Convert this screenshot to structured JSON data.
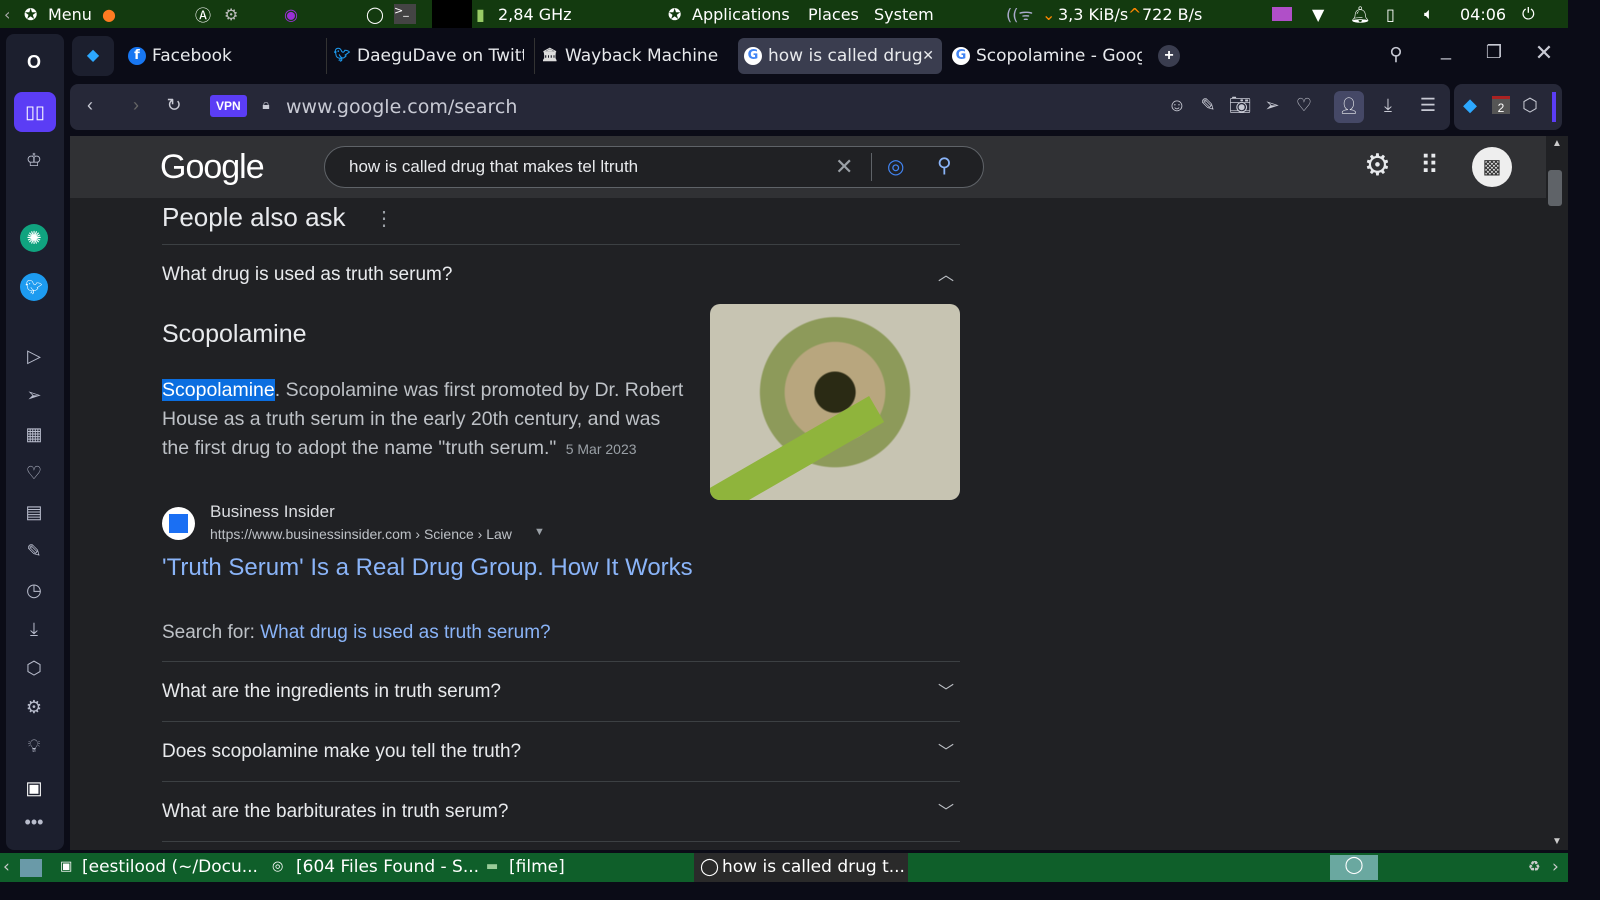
{
  "topbar": {
    "menu": "Menu",
    "cpu": "2,84 GHz",
    "applications": "Applications",
    "places": "Places",
    "system": "System",
    "net_down": "3,3 KiB/s",
    "net_up": "722 B/s",
    "clock": "04:06"
  },
  "tabs": [
    {
      "label": "Facebook"
    },
    {
      "label": "DaeguDave on Twitt"
    },
    {
      "label": "Wayback Machine"
    },
    {
      "label": "how is called drug"
    },
    {
      "label": "Scopolamine - Googl"
    }
  ],
  "address": {
    "vpn": "VPN",
    "url": "www.google.com/search"
  },
  "extensions": {
    "badge": "2"
  },
  "google": {
    "logo": "Google",
    "query": "how is called drug that makes tel ltruth"
  },
  "paa": {
    "title": "People also ask",
    "expanded_question": "What drug is used as truth serum?",
    "answer_title": "Scopolamine",
    "answer_highlight": "Scopolamine",
    "answer_text": ". Scopolamine was first promoted by Dr. Robert House as a truth serum in the early 20th century, and was the first drug to adopt the name \"truth serum.\"",
    "answer_date": "5 Mar 2023",
    "source_name": "Business Insider",
    "source_url": "https://www.businessinsider.com › Science › Law",
    "result_title": "'Truth Serum' Is a Real Drug Group. How It Works",
    "search_for_label": "Search for: ",
    "search_for_link": "What drug is used as truth serum?",
    "questions": [
      "What are the ingredients in truth serum?",
      "Does scopolamine make you tell the truth?",
      "What are the barbiturates in truth serum?"
    ]
  },
  "taskbar": {
    "items": [
      "[eestilood (~/Docu...",
      "[604 Files Found - S...",
      "[filme]",
      "how is called drug t..."
    ]
  }
}
